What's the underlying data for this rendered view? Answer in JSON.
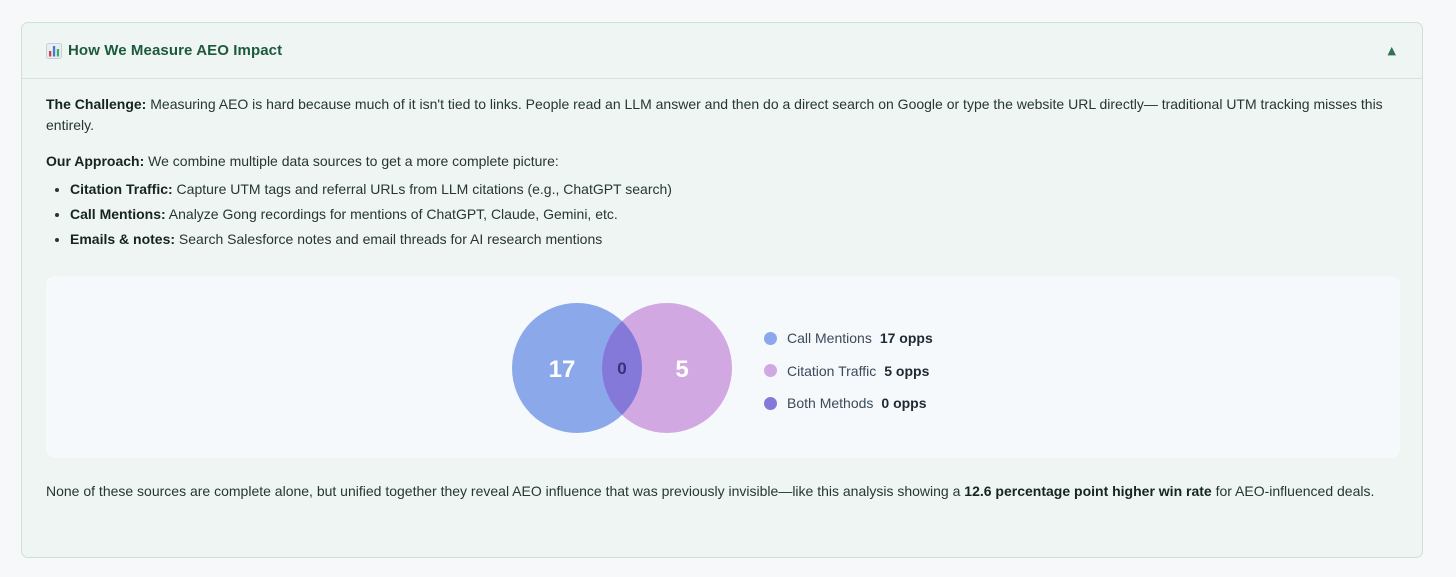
{
  "header": {
    "title": "How We Measure AEO Impact",
    "collapse_glyph": "▲"
  },
  "challenge": {
    "label": "The Challenge:",
    "text": " Measuring AEO is hard because much of it isn't tied to links. People read an LLM answer and then do a direct search on Google or type the website URL directly— traditional UTM tracking misses this entirely."
  },
  "approach": {
    "label": "Our Approach:",
    "text": " We combine multiple data sources to get a more complete picture:",
    "items": [
      {
        "label": "Citation Traffic:",
        "text": " Capture UTM tags and referral URLs from LLM citations (e.g., ChatGPT search)"
      },
      {
        "label": "Call Mentions:",
        "text": " Analyze Gong recordings for mentions of ChatGPT, Claude, Gemini, etc."
      },
      {
        "label": "Emails & notes:",
        "text": " Search Salesforce notes and email threads for AI research mentions"
      }
    ]
  },
  "venn": {
    "left_value": "17",
    "overlap_value": "0",
    "right_value": "5",
    "colors": {
      "left": "#8aa8ea",
      "right": "#d2a8e2",
      "overlap": "#8478d8"
    }
  },
  "legend": [
    {
      "label": "Call Mentions",
      "value": "17 opps",
      "color": "#8aa8ea"
    },
    {
      "label": "Citation Traffic",
      "value": "5 opps",
      "color": "#d2a8e2"
    },
    {
      "label": "Both Methods",
      "value": "0 opps",
      "color": "#8478d8"
    }
  ],
  "footer": {
    "text_before": "None of these sources are complete alone, but unified together they reveal AEO influence that was previously invisible—like this analysis showing a ",
    "highlight": "12.6 percentage point higher win rate",
    "text_after": " for AEO-influenced deals."
  }
}
